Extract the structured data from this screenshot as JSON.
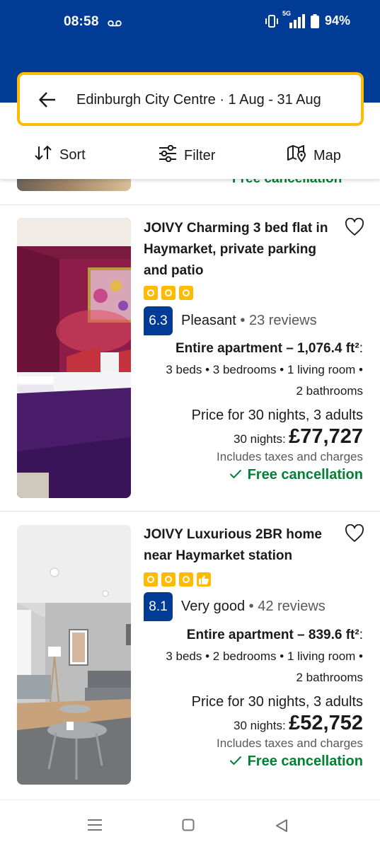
{
  "status_bar": {
    "time": "08:58",
    "battery": "94%",
    "network": "5G"
  },
  "search": {
    "summary": "Edinburgh City Centre · 1 Aug - 31 Aug"
  },
  "toolbar": {
    "sort_label": "Sort",
    "filter_label": "Filter",
    "map_label": "Map"
  },
  "previous_card": {
    "cancellation": "Free cancellation"
  },
  "listings": [
    {
      "title": "JOIVY Charming 3 bed flat in Haymarket, private parking and patio",
      "stars": 3,
      "preferred_badge": false,
      "score": "6.3",
      "score_word": "Pleasant",
      "reviews": "23 reviews",
      "apartment_type": "Entire apartment – 1,076.4 ft²",
      "beds_line_1": "3 beds • 3 bedrooms • 1 living room •",
      "beds_line_2": "2 bathrooms",
      "price_for": "Price for 30 nights, 3 adults",
      "nights_label": "30 nights:",
      "price": "£77,727",
      "taxes": "Includes taxes and charges",
      "cancellation": "Free cancellation"
    },
    {
      "title": "JOIVY Luxurious 2BR home near Haymarket station",
      "stars": 3,
      "preferred_badge": true,
      "score": "8.1",
      "score_word": "Very good",
      "reviews": "42 reviews",
      "apartment_type": "Entire apartment – 839.6 ft²",
      "beds_line_1": "3 beds • 2 bedrooms • 1 living room •",
      "beds_line_2": "2 bathrooms",
      "price_for": "Price for 30 nights, 3 adults",
      "nights_label": "30 nights:",
      "price": "£52,752",
      "taxes": "Includes taxes and charges",
      "cancellation": "Free cancellation"
    }
  ],
  "colors": {
    "brand_blue": "#003b95",
    "search_border": "#febb02",
    "success_green": "#008234"
  }
}
